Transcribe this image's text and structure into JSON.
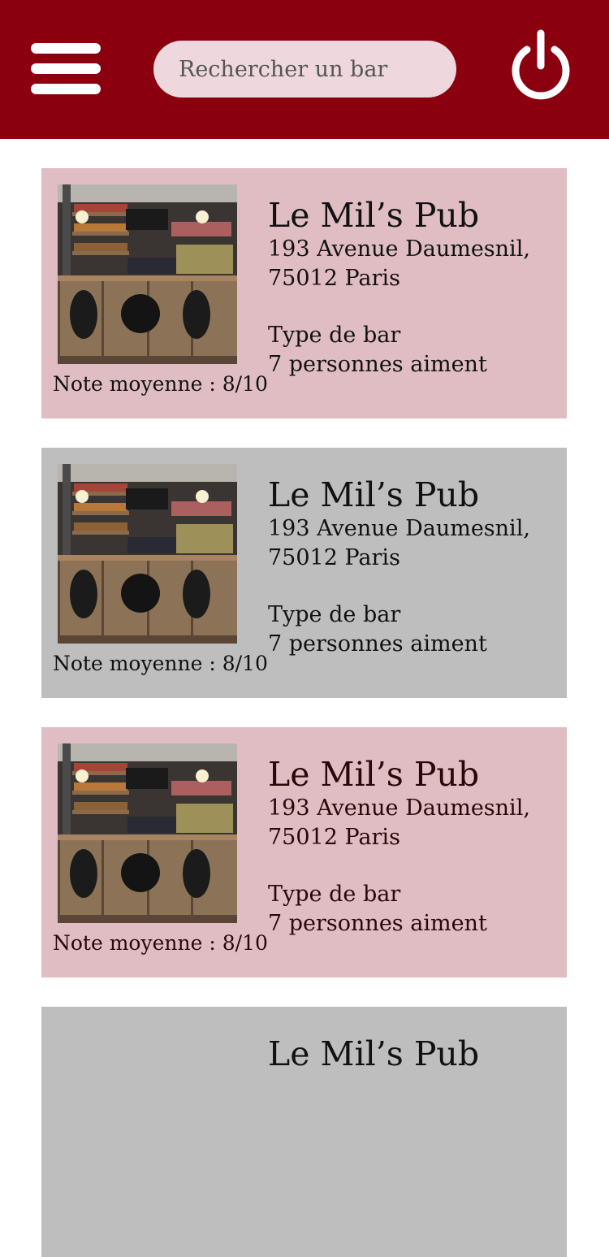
{
  "header": {
    "search_placeholder": "Rechercher un bar"
  },
  "colors": {
    "brand": "#8a000f",
    "card_pink": "#e0bdc2",
    "card_grey": "#bebebe",
    "search_bg": "#efd8dd"
  },
  "bars": [
    {
      "name": "Le Mil’s Pub",
      "address_line1": "193 Avenue Daumesnil,",
      "address_line2": "75012 Paris",
      "type": "Type de bar",
      "likes": "7 personnes aiment",
      "rating": "Note moyenne : 8/10"
    },
    {
      "name": "Le Mil’s Pub",
      "address_line1": "193 Avenue Daumesnil,",
      "address_line2": "75012 Paris",
      "type": "Type de bar",
      "likes": "7 personnes aiment",
      "rating": "Note moyenne : 8/10"
    },
    {
      "name": "Le Mil’s Pub",
      "address_line1": "193 Avenue Daumesnil,",
      "address_line2": "75012 Paris",
      "type": "Type de bar",
      "likes": "7 personnes aiment",
      "rating": "Note moyenne : 8/10"
    },
    {
      "name": "Le Mil’s Pub"
    }
  ]
}
